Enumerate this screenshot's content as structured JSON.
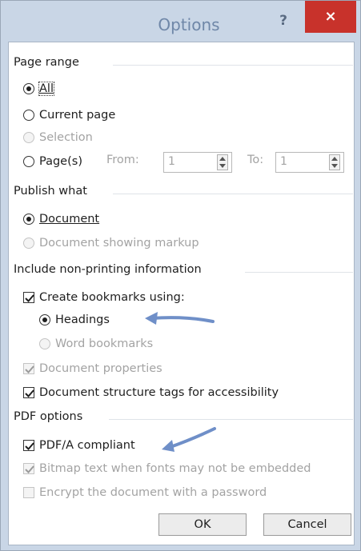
{
  "window": {
    "title": "Options",
    "help_label": "?",
    "close_label": "×"
  },
  "page_range": {
    "label": "Page range",
    "all": "All",
    "current": "Current page",
    "selection": "Selection",
    "pages": "Page(s)",
    "from_label": "From:",
    "from_value": "1",
    "to_label": "To:",
    "to_value": "1"
  },
  "publish_what": {
    "label": "Publish what",
    "document": "Document",
    "markup": "Document showing markup"
  },
  "nonprinting": {
    "label": "Include non-printing information",
    "bookmarks": "Create bookmarks using:",
    "headings": "Headings",
    "word_bookmarks": "Word bookmarks",
    "doc_props": "Document properties",
    "struct_tags": "Document structure tags for accessibility"
  },
  "pdf_options": {
    "label": "PDF options",
    "pdfa": "PDF/A compliant",
    "bitmap": "Bitmap text when fonts may not be embedded",
    "encrypt": "Encrypt the document with a password"
  },
  "buttons": {
    "ok": "OK",
    "cancel": "Cancel"
  },
  "colors": {
    "annotation_arrow": "#6f8fc8",
    "close_button": "#c8322b"
  }
}
